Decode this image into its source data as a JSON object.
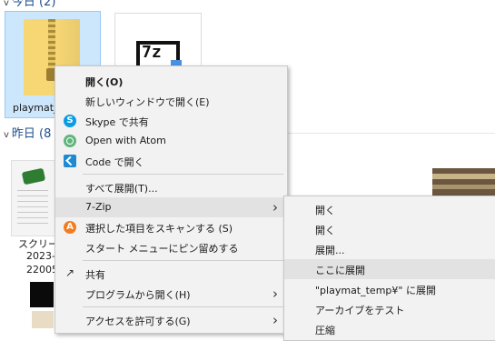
{
  "groups": {
    "today": {
      "label": "今日 (2)"
    },
    "yesterday": {
      "label": "昨日 (8"
    }
  },
  "files": {
    "zip": {
      "label": "playmat_"
    },
    "screenshot": {
      "line1": "スクリーン",
      "line2": "2023-",
      "line3": "22005"
    }
  },
  "context_menu": {
    "open": "開く(O)",
    "open_new_window": "新しいウィンドウで開く(E)",
    "skype_share": "Skype で共有",
    "open_with_atom": "Open with Atom",
    "open_in_code": "Code で開く",
    "extract_all": "すべて展開(T)...",
    "seven_zip": "7-Zip",
    "scan_selected": "選択した項目をスキャンする (S)",
    "pin_to_start": "スタート メニューにピン留めする",
    "share": "共有",
    "open_with": "プログラムから開く(H)",
    "grant_access": "アクセスを許可する(G)"
  },
  "seven_zip_menu": {
    "open1": "開く",
    "open2": "開く",
    "extract": "展開...",
    "extract_here": "ここに展開",
    "extract_to_folder": "\"playmat_temp¥\" に展開",
    "test_archive": "アーカイブをテスト",
    "compress": "圧縮"
  },
  "icons": {
    "skype": "S",
    "avast": "A",
    "share": "↗",
    "submenu_arrow": "›",
    "seven_zip_logo": "7z",
    "chevron": "v"
  },
  "colors": {
    "selection": "#cce6fb",
    "menu_background": "#f2f2f2",
    "menu_hover": "#e2e2e2",
    "header_blue": "#1e4e8c"
  }
}
